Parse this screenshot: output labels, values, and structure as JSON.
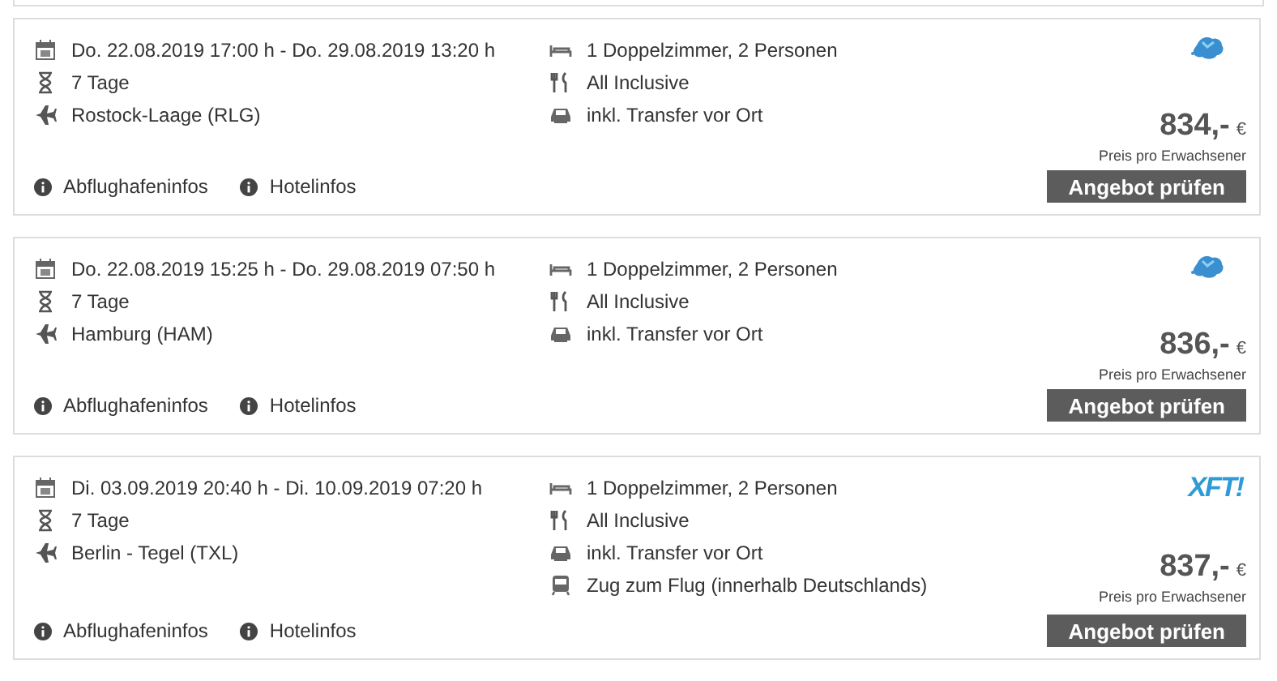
{
  "offers": [
    {
      "details": [
        {
          "kind": "date",
          "text": "Do. 22.08.2019 17:00 h - Do. 29.08.2019 13:20 h"
        },
        {
          "kind": "duration",
          "text": "7 Tage"
        },
        {
          "kind": "flight",
          "text": "Rostock-Laage (RLG)"
        }
      ],
      "services": [
        {
          "kind": "room",
          "text": "1 Doppelzimmer, 2 Personen"
        },
        {
          "kind": "meal",
          "text": "All Inclusive"
        },
        {
          "kind": "transfer",
          "text": "inkl. Transfer vor Ort"
        }
      ],
      "operator_logo": {
        "kind": "blob"
      },
      "price": "834,-",
      "currency": "€",
      "price_note": "Preis pro Erwachsener",
      "links": [
        "Abflughafeninfos",
        "Hotelinfos"
      ],
      "button": "Angebot prüfen"
    },
    {
      "details": [
        {
          "kind": "date",
          "text": "Do. 22.08.2019 15:25 h - Do. 29.08.2019 07:50 h"
        },
        {
          "kind": "duration",
          "text": "7 Tage"
        },
        {
          "kind": "flight",
          "text": "Hamburg (HAM)"
        }
      ],
      "services": [
        {
          "kind": "room",
          "text": "1 Doppelzimmer, 2 Personen"
        },
        {
          "kind": "meal",
          "text": "All Inclusive"
        },
        {
          "kind": "transfer",
          "text": "inkl. Transfer vor Ort"
        }
      ],
      "operator_logo": {
        "kind": "blob"
      },
      "price": "836,-",
      "currency": "€",
      "price_note": "Preis pro Erwachsener",
      "links": [
        "Abflughafeninfos",
        "Hotelinfos"
      ],
      "button": "Angebot prüfen"
    },
    {
      "details": [
        {
          "kind": "date",
          "text": "Di. 03.09.2019 20:40 h - Di. 10.09.2019 07:20 h"
        },
        {
          "kind": "duration",
          "text": "7 Tage"
        },
        {
          "kind": "flight",
          "text": "Berlin - Tegel (TXL)"
        }
      ],
      "services": [
        {
          "kind": "room",
          "text": "1 Doppelzimmer, 2 Personen"
        },
        {
          "kind": "meal",
          "text": "All Inclusive"
        },
        {
          "kind": "transfer",
          "text": "inkl. Transfer vor Ort"
        },
        {
          "kind": "train",
          "text": "Zug zum Flug (innerhalb Deutschlands)"
        }
      ],
      "operator_logo": {
        "kind": "text",
        "text": "XFT!"
      },
      "price": "837,-",
      "currency": "€",
      "price_note": "Preis pro Erwachsener",
      "links": [
        "Abflughafeninfos",
        "Hotelinfos"
      ],
      "button": "Angebot prüfen"
    }
  ]
}
